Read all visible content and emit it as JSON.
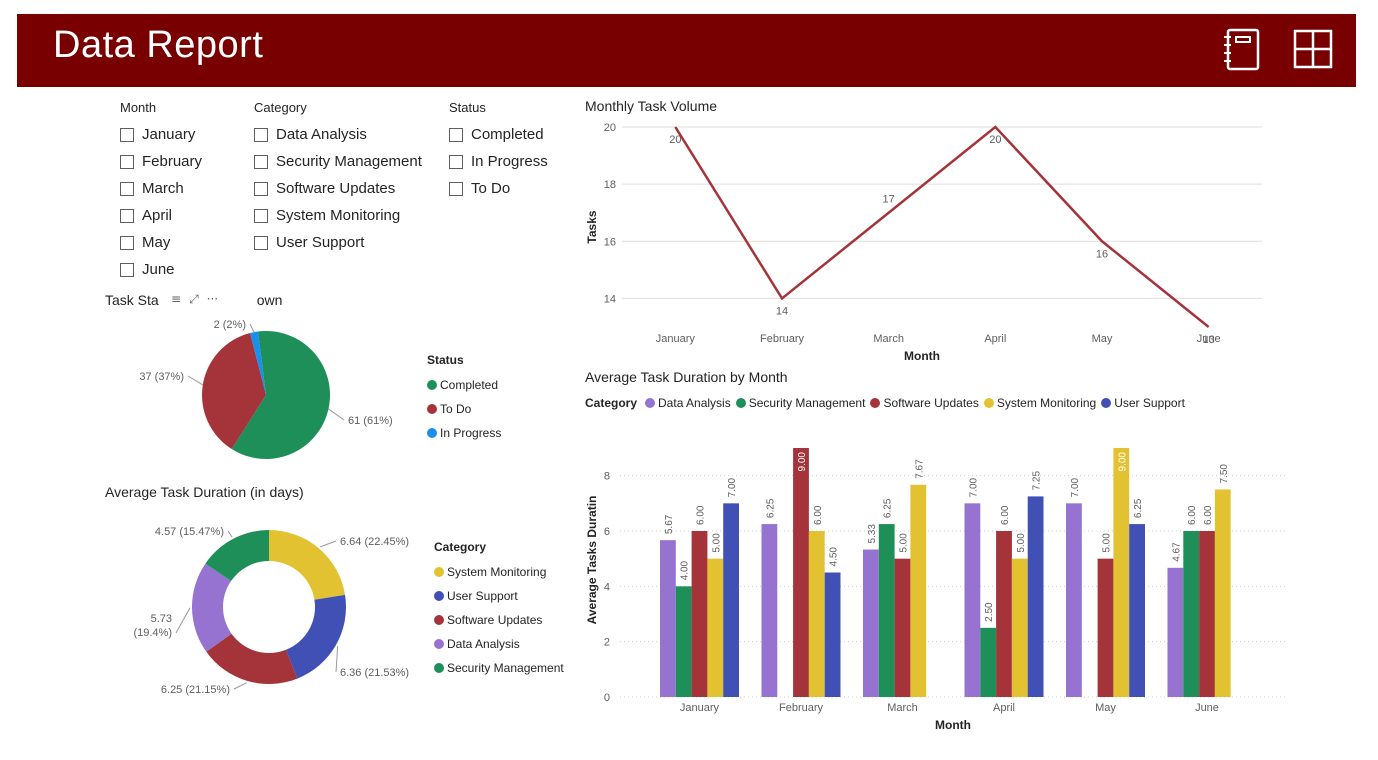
{
  "header": {
    "title": "Data Report",
    "icons": [
      "notebook-icon",
      "layout-icon"
    ],
    "bg": "#780000"
  },
  "slicers": [
    {
      "title": "Month",
      "items": [
        "January",
        "February",
        "March",
        "April",
        "May",
        "June"
      ]
    },
    {
      "title": "Category",
      "items": [
        "Data Analysis",
        "Security Management",
        "Software Updates",
        "System Monitoring",
        "User Support"
      ]
    },
    {
      "title": "Status",
      "items": [
        "Completed",
        "In Progress",
        "To Do"
      ]
    }
  ],
  "pie_visual": {
    "title_left": "Task Sta",
    "title_right": "own",
    "hover_icons": [
      "≡",
      "⤢",
      "···"
    ]
  },
  "donut_visual": {
    "title": "Average Task Duration (in days)"
  },
  "line_visual": {
    "title": "Monthly Task Volume"
  },
  "bar_visual": {
    "title": "Average Task Duration by Month"
  },
  "colors": {
    "Completed": "#1e8f58",
    "To Do": "#a4343a",
    "In Progress": "#1a8ff0",
    "Data Analysis": "#9673d1",
    "Security Management": "#1e8f58",
    "Software Updates": "#a4343a",
    "System Monitoring": "#e3c232",
    "User Support": "#4150b5",
    "line": "#a4343a"
  },
  "chart_data": [
    {
      "type": "pie",
      "legend_title": "Status",
      "legend_placement": "right",
      "slices": [
        {
          "label": "Completed",
          "value": 61,
          "text": "61 (61%)"
        },
        {
          "label": "To Do",
          "value": 37,
          "text": "37 (37%)"
        },
        {
          "label": "In Progress",
          "value": 2,
          "text": "2 (2%)"
        }
      ]
    },
    {
      "type": "pie",
      "legend_title": "Category",
      "legend_placement": "right",
      "slices": [
        {
          "label": "System Monitoring",
          "value": 6.64,
          "text": "6.64 (22.45%)"
        },
        {
          "label": "User Support",
          "value": 6.36,
          "text": "6.36 (21.53%)"
        },
        {
          "label": "Software Updates",
          "value": 6.25,
          "text": "6.25 (21.15%)"
        },
        {
          "label": "Data Analysis",
          "value": 5.73,
          "text": "5.73 (19.4%)"
        },
        {
          "label": "Security Management",
          "value": 4.57,
          "text": "4.57 (15.47%)"
        }
      ]
    },
    {
      "type": "line",
      "title": "Monthly Task Volume",
      "xlabel": "Month",
      "ylabel": "Tasks",
      "categories": [
        "January",
        "February",
        "March",
        "April",
        "May",
        "June"
      ],
      "values": [
        20,
        14,
        17,
        20,
        16,
        13
      ],
      "yticks": [
        14,
        16,
        18,
        20
      ],
      "grid": true
    },
    {
      "type": "bar",
      "title": "Average Task Duration by Month",
      "xlabel": "Month",
      "ylabel": "Average Tasks Duratin",
      "legend_title": "Category",
      "legend_placement": "top-left",
      "ylim": [
        0,
        9
      ],
      "yticks": [
        0,
        2,
        4,
        6,
        8
      ],
      "categories": [
        "January",
        "February",
        "March",
        "April",
        "May",
        "June"
      ],
      "series": [
        {
          "name": "Data Analysis",
          "values": [
            5.67,
            6.25,
            5.33,
            7.0,
            7.0,
            4.67
          ]
        },
        {
          "name": "Security Management",
          "values": [
            4.0,
            null,
            6.25,
            2.5,
            null,
            6.0
          ]
        },
        {
          "name": "Software Updates",
          "values": [
            6.0,
            9.0,
            5.0,
            6.0,
            5.0,
            6.0
          ]
        },
        {
          "name": "System Monitoring",
          "values": [
            5.0,
            6.0,
            7.67,
            5.0,
            9.0,
            7.5
          ]
        },
        {
          "name": "User Support",
          "values": [
            7.0,
            4.5,
            null,
            7.25,
            6.25,
            null
          ]
        }
      ],
      "value_labels": {
        "Data Analysis": [
          "5.67",
          "6.25",
          "5.33",
          "7.00",
          "7.00",
          "4.67"
        ],
        "Security Management": [
          "4.00",
          null,
          "6.25",
          "2.50",
          null,
          "6.00"
        ],
        "Software Updates": [
          "6.00",
          "9.00",
          "5.00",
          "6.00",
          "5.00",
          "6.00"
        ],
        "System Monitoring": [
          "5.00",
          "6.00",
          "7.67",
          "5.00",
          "9.00",
          "7.50"
        ],
        "User Support": [
          "7.00",
          "4.50",
          null,
          "7.25",
          "6.25",
          null
        ]
      }
    }
  ]
}
